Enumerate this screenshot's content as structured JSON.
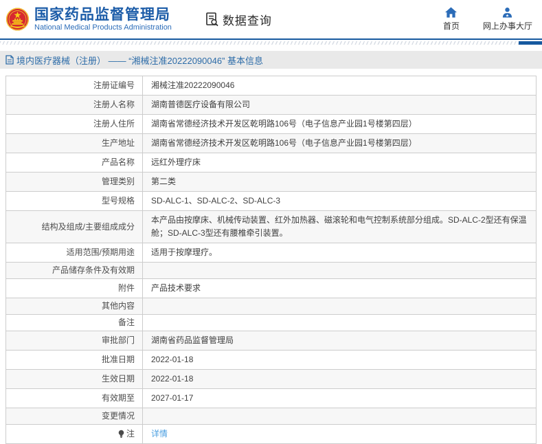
{
  "header": {
    "logo": "china-national-emblem",
    "org_name_zh": "国家药品监督管理局",
    "org_name_en": "National Medical Products Administration",
    "section_title": "数据查询",
    "nav_home": "首页",
    "nav_hall": "网上办事大厅"
  },
  "breadcrumb": {
    "text": "境内医疗器械（注册） —— “湘械注准20222090046” 基本信息"
  },
  "detail_table": {
    "rows": [
      {
        "label": "注册证编号",
        "value": "湘械注准20222090046"
      },
      {
        "label": "注册人名称",
        "value": "湖南普德医疗设备有限公司"
      },
      {
        "label": "注册人住所",
        "value": "湖南省常德经济技术开发区乾明路106号（电子信息产业园1号楼第四层）"
      },
      {
        "label": "生产地址",
        "value": "湖南省常德经济技术开发区乾明路106号（电子信息产业园1号楼第四层）"
      },
      {
        "label": "产品名称",
        "value": "远红外理疗床"
      },
      {
        "label": "管理类别",
        "value": "第二类"
      },
      {
        "label": "型号规格",
        "value": "SD-ALC-1、SD-ALC-2、SD-ALC-3"
      },
      {
        "label": "结构及组成/主要组成成分",
        "value": "本产品由按摩床、机械传动装置、红外加热器、磁滚轮和电气控制系统部分组成。SD-ALC-2型还有保温舱；SD-ALC-3型还有腰椎牵引装置。"
      },
      {
        "label": "适用范围/预期用途",
        "value": "适用于按摩理疗。"
      },
      {
        "label": "产品储存条件及有效期",
        "value": ""
      },
      {
        "label": "附件",
        "value": "产品技术要求"
      },
      {
        "label": "其他内容",
        "value": ""
      },
      {
        "label": "备注",
        "value": ""
      },
      {
        "label": "审批部门",
        "value": "湖南省药品监督管理局"
      },
      {
        "label": "批准日期",
        "value": "2022-01-18"
      },
      {
        "label": "生效日期",
        "value": "2022-01-18"
      },
      {
        "label": "有效期至",
        "value": "2027-01-17"
      },
      {
        "label": "变更情况",
        "value": ""
      },
      {
        "label": "注",
        "value": "详情"
      }
    ]
  },
  "colors": {
    "brand_blue": "#1c5ca8",
    "icon_blue": "#2b6cb8",
    "link_blue": "#4a9ee0",
    "row_alt_bg": "#f7f7f7",
    "border": "#cccccc",
    "breadcrumb_bg": "#e9e9e9"
  }
}
